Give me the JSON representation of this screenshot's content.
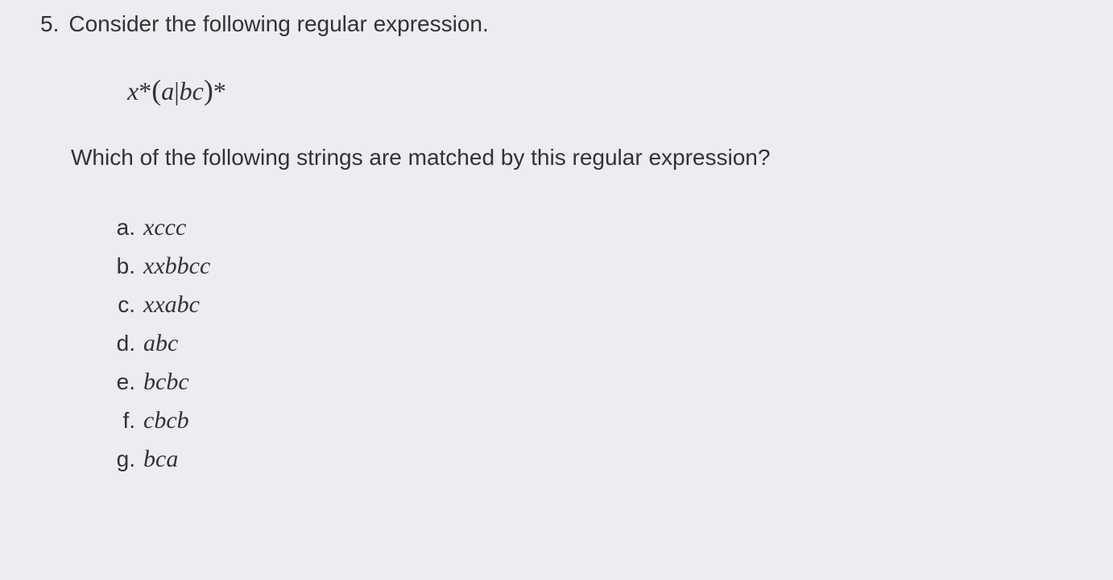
{
  "question": {
    "number": "5.",
    "intro": "Consider the following regular expression.",
    "formula_parts": {
      "var_x": "x",
      "star1": "*",
      "lparen": "(",
      "a": "a",
      "pipe": "|",
      "bc": "bc",
      "rparen": ")",
      "star2": "*"
    },
    "prompt": "Which of the following strings are matched by this regular expression?",
    "options": [
      {
        "letter": "a.",
        "value": "xccc"
      },
      {
        "letter": "b.",
        "value": "xxbbcc"
      },
      {
        "letter": "c.",
        "value": "xxabc"
      },
      {
        "letter": "d.",
        "value": "abc"
      },
      {
        "letter": "e.",
        "value": "bcbc"
      },
      {
        "letter": "f.",
        "value": "cbcb"
      },
      {
        "letter": "g.",
        "value": "bca"
      }
    ]
  }
}
